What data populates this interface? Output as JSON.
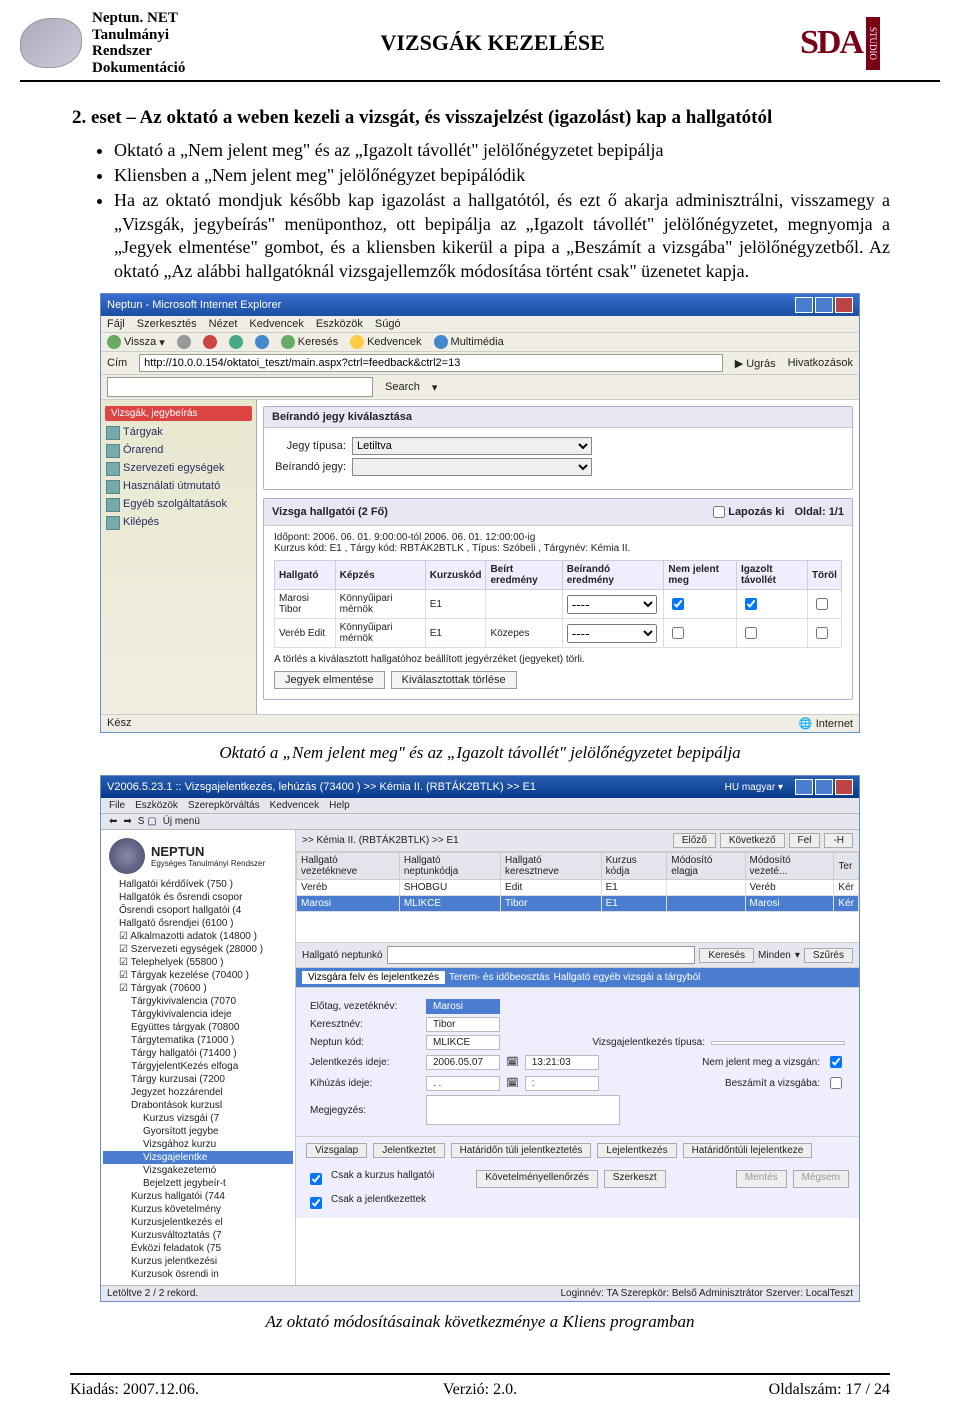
{
  "header": {
    "left_lines": [
      "Neptun. NET",
      "Tanulmányi",
      "Rendszer",
      "Dokumentáció"
    ],
    "title": "VIZSGÁK KEZELÉSE",
    "right_brand": "SDA",
    "right_sub": "STUDIO"
  },
  "body": {
    "heading": "2. eset – Az oktató a weben kezeli a vizsgát, és visszajelzést (igazolást) kap a hallgatótól",
    "bullets": [
      "Oktató a „Nem jelent meg\" és az „Igazolt távollét\" jelölőnégyzetet bepipálja",
      "Kliensben a „Nem jelent meg\" jelölőnégyzet bepipálódik",
      "Ha az oktató mondjuk később kap igazolást a hallgatótól, és ezt ő akarja adminisztrálni, visszamegy a „Vizsgák, jegybeírás\" menüponthoz, ott bepipálja az „Igazolt távollét\" jelölőnégyzetet, megnyomja a „Jegyek elmentése\" gombot, és a kliensben kikerül a pipa a „Beszámít a vizsgába\" jelölőnégyzetből. Az oktató „Az alábbi hallgatóknál vizsgajellemzők módosítása történt csak\" üzenetet kapja."
    ]
  },
  "ss1": {
    "title": "Neptun - Microsoft Internet Explorer",
    "menu": [
      "Fájl",
      "Szerkesztés",
      "Nézet",
      "Kedvencek",
      "Eszközök",
      "Súgó"
    ],
    "tb": {
      "back": "Vissza",
      "search": "Keresés",
      "fav": "Kedvencek",
      "media": "Multimédia"
    },
    "address_label": "Cím",
    "address": "http://10.0.0.154/oktatoi_teszt/main.aspx?ctrl=feedback&ctrl2=13",
    "go": "Ugrás",
    "links": "Hivatkozások",
    "search_btn": "Search",
    "side_tab": "Vizsgák, jegybeírás",
    "side_items": [
      "Tárgyak",
      "Órarend",
      "Szervezeti egységek",
      "Használati útmutató",
      "Egyéb szolgáltatások",
      "Kilépés"
    ],
    "panel1_title": "Beírandó jegy kiválasztása",
    "f1_label": "Jegy típusa:",
    "f1_value": "Letiltva",
    "f2_label": "Beírandó jegy:",
    "panel2_title": "Vizsga hallgatói (2 Fő)",
    "lapozas": "Lapozás ki",
    "page": "Oldal: 1/1",
    "meta": "Időpont: 2006. 06. 01. 9:00:00-tól 2006. 06. 01. 12:00:00-ig\nKurzus kód: E1 , Tárgy kód: RBTÁK2BTLK , Típus: Szóbeli , Tárgynév: Kémia II.",
    "cols": [
      "Hallgató",
      "Képzés",
      "Kurzuskód",
      "Beírt eredmény",
      "Beírandó eredmény",
      "Nem jelent meg",
      "Igazolt távollét",
      "Töröl"
    ],
    "rows": [
      {
        "name": "Marosi Tibor",
        "kepzes": "Könnyűipari mérnök",
        "kk": "E1",
        "beirt": "",
        "beirando": "----",
        "njm": true,
        "it": true,
        "del": false
      },
      {
        "name": "Veréb Edit",
        "kepzes": "Könnyűipari mérnök",
        "kk": "E1",
        "beirt": "Közepes",
        "beirando": "----",
        "njm": false,
        "it": false,
        "del": false
      }
    ],
    "note": "A törlés a kiválasztott hallgatóhoz beállított jegyérzéket (jegyeket) törli.",
    "btn1": "Jegyek elmentése",
    "btn2": "Kiválasztottak törlése",
    "status_left": "Kész",
    "status_right": "Internet"
  },
  "caption1": "Oktató a „Nem jelent meg\" és az „Igazolt távollét\" jelölőnégyzetet bepipálja",
  "ss2": {
    "title": "V2006.5.23.1 :: Vizsgajelentkezés, lehúzás (73400 ) >> Kémia II. (RBTÁK2BTLK) >> E1",
    "topmenu": [
      "File",
      "Eszközök",
      "Szerepkörváltás",
      "Kedvencek",
      "Help"
    ],
    "umenu": "Új menü",
    "brand": "NEPTUN",
    "brand_sub": "Egységes Tanulmányi Rendszer",
    "tree": [
      "Hallgatói kérdőívek (750 )",
      "Hallgatók és ősrendi csopor",
      "Ősrendi csoport hallgatói (4",
      "Hallgató ősrendjei (6100 )",
      "Alkalmazotti adatok (14800 )",
      "Szervezeti egységek (28000 )",
      "Telephelyek (55800 )",
      "Tárgyak kezelése (70400 )",
      "Tárgyak (70600 )",
      "Tárgykivivalencia (7070",
      "Tárgykivivalencia ideje",
      "Együttes tárgyak (70800",
      "Tárgytematika (71000 )",
      "Tárgy hallgatói (71400 )",
      "TárgyjelentKezés elfoga",
      "Tárgy kurzusai (7200",
      "Jegyzet hozzárendel",
      "Drabontások kurzusl",
      "Kurzus vizsgái (7",
      "Gyorsított jegybe",
      "Vizsgához kurzu",
      "Vizsgajelentke",
      "Vizsgakezetemó",
      "Bejelzett jegybeír-t",
      "Kurzus hallgatói (744",
      "Kurzus követelmény",
      "Kurzusjelentkezés el",
      "Kurzusváltoztatás (7",
      "Évközi feladatok (75",
      "Kurzus jelentkezési",
      "Kurzusok ösrendi in"
    ],
    "tree_selected": "Vizsgajelentke",
    "bread": ">> Kémia II. (RBTÁK2BTLK) >> E1",
    "nav": {
      "prev": "Előző",
      "refresh": "Következő",
      "up": "Fel",
      "close": "-H"
    },
    "grid_cols": [
      "Hallgató vezetékneve",
      "Hallgató neptunkódja",
      "Hallgató keresztneve",
      "Kurzus kódja",
      "Módosító elagja",
      "Módosító vezeté...",
      "Ter"
    ],
    "grid_rows": [
      [
        "Veréb",
        "SHOBGU",
        "Edit",
        "E1",
        "",
        "Veréb",
        "Kér"
      ],
      [
        "Marosi",
        "MLIKCE",
        "Tibor",
        "E1",
        "",
        "Marosi",
        "Kér"
      ]
    ],
    "search_label": "Hallgató neptunkó",
    "search_btn": "Keresés",
    "search_scope": "Minden",
    "search_go": "Szűrés",
    "tab_strip": [
      "Vizsgára felv és lejelentkezés",
      "Terem- és időbeosztás",
      "Hallgató egyéb vizsgái a tárgyból"
    ],
    "form": {
      "r1l": "Előtag, vezetéknév:",
      "r1v": "Marosi",
      "r2l": "Keresztnév:",
      "r2v": "Tibor",
      "r3l": "Neptun kód:",
      "r3v": "MLIKCE",
      "r4l": "Jelentkezés ideje:",
      "r4v1": "2006.05.07",
      "r4v2": "13:21:03",
      "r5l": "Kihúzás ideje:",
      "r5v1": ". .",
      "r5v2": ":",
      "sidea": "Vizsgajelentkezés típusa:",
      "sideb": "Nem jelent meg a vizsgán:",
      "sidec": "Beszámít a vizsgába:",
      "r6l": "Megjegyzés:"
    },
    "bottom_buttons": [
      "Vizsgalap",
      "Jelentkeztet",
      "Határidőn túli jelentkeztetés",
      "Lejelentkezés",
      "Határidőntúli lejelentkeze"
    ],
    "chk1": "Csak a kurzus hallgatói",
    "chk2": "Csak a jelentkezettek",
    "mid_btn1": "Követelményellenőrzés",
    "mid_btn2": "Szerkeszt",
    "save": "Mentés",
    "cancel": "Mégsem",
    "status_left": "Letöltve 2 / 2 rekord.",
    "status_right": "Loginnév: TA  Szerepkör: Belső Adminisztrátor  Szerver: LocalTeszt"
  },
  "caption2": "Az oktató módosításainak következménye a Kliens programban",
  "footer": {
    "left": "Kiadás: 2007.12.06.",
    "center": "Verzió: 2.0.",
    "right": "Oldalszám: 17 / 24"
  }
}
